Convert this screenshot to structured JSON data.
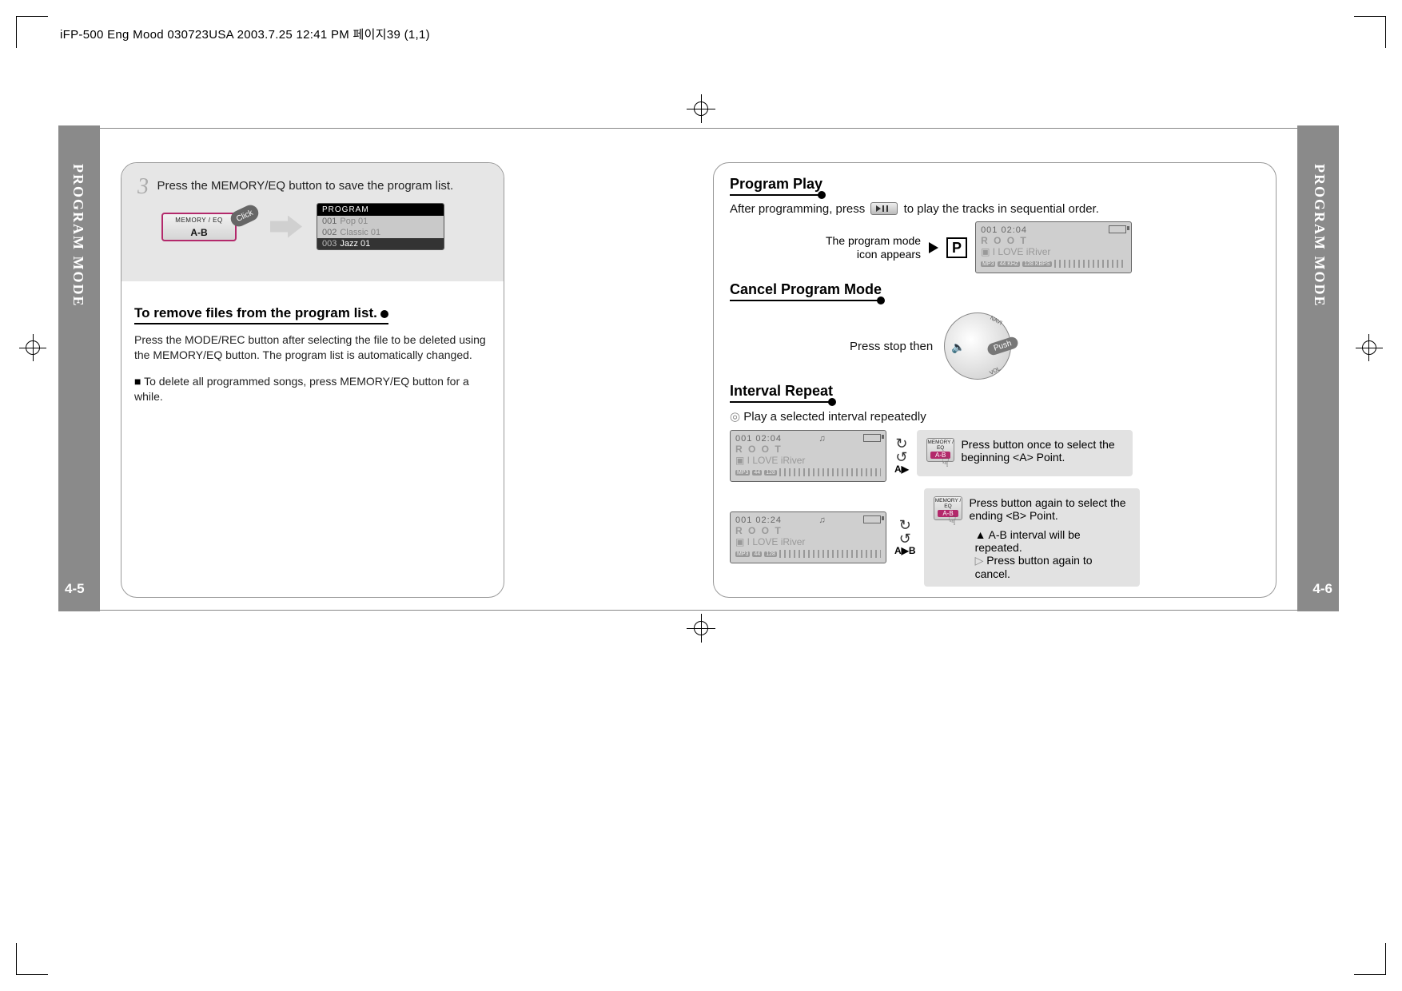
{
  "header": "iFP-500 Eng Mood 030723USA  2003.7.25  12:41 PM  페이지39 (1,1)",
  "sidebar_label": "PROGRAM MODE",
  "page_left_num": "4-5",
  "page_right_num": "4-6",
  "left": {
    "step3_text": "Press the MEMORY/EQ button to save the program list.",
    "mem_label_top": "MEMORY / EQ",
    "mem_label_main": "A-B",
    "click": "Click",
    "prog_header": "PROGRAM",
    "prog_rows": [
      {
        "n": "001",
        "t": "Pop 01"
      },
      {
        "n": "002",
        "t": "Classic 01"
      },
      {
        "n": "003",
        "t": "Jazz 01"
      }
    ],
    "remove_head": "To remove files from the program list.",
    "remove_para": "Press the MODE/REC button after selecting the file to be deleted using the MEMORY/EQ button.  The program list is automatically changed.",
    "delete_all": "To delete all programmed songs, press MEMORY/EQ button for a while."
  },
  "right": {
    "h1": "Program Play",
    "after_prog_a": "After programming, press",
    "after_prog_b": "to play the tracks in sequential order.",
    "icon_text1": "The program mode",
    "icon_text2": "icon appears",
    "p_badge": "P",
    "disp1": {
      "time": "001 02:04",
      "root": "R O O T",
      "song": "I LOVE iRiver",
      "mp": "MP3",
      "khz": "44 KHZ",
      "kbps": "128 KBPS"
    },
    "h2": "Cancel Program Mode",
    "cancel_text": "Press stop then",
    "navi": "NAVI",
    "vol": "VOL",
    "push": "Push",
    "h3": "Interval Repeat",
    "interval_sub": "Play a selected interval repeatedly",
    "disp2": {
      "time": "001 02:04",
      "root": "R O O T",
      "song": "I LOVE iRiver"
    },
    "disp3": {
      "time": "001 02:24",
      "root": "R O O T",
      "song": "I LOVE iRiver"
    },
    "a_lbl": "A▶",
    "ab_lbl": "A▶B",
    "ab_text1": "Press button once to select the beginning <A> Point.",
    "ab_text2": "Press button again to select the ending <B> Point.",
    "ab_note1": "A-B interval will be repeated.",
    "ab_note2": "Press button again to cancel.",
    "memtop": "MEMORY / EQ",
    "memmain": "A-B"
  }
}
